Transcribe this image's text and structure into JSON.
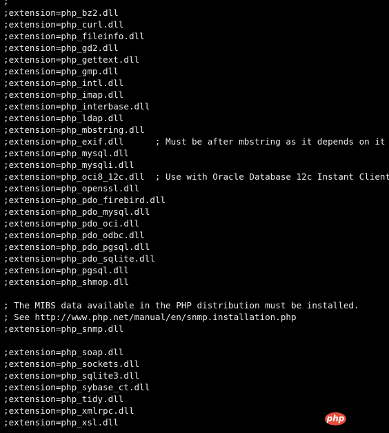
{
  "colors": {
    "background": "#000000",
    "text": "#ececec",
    "badge": "#e74c3c"
  },
  "lines": [
    ";",
    ";extension=php_bz2.dll",
    ";extension=php_curl.dll",
    ";extension=php_fileinfo.dll",
    ";extension=php_gd2.dll",
    ";extension=php_gettext.dll",
    ";extension=php_gmp.dll",
    ";extension=php_intl.dll",
    ";extension=php_imap.dll",
    ";extension=php_interbase.dll",
    ";extension=php_ldap.dll",
    ";extension=php_mbstring.dll",
    ";extension=php_exif.dll      ; Must be after mbstring as it depends on it",
    ";extension=php_mysql.dll",
    ";extension=php_mysqli.dll",
    ";extension=php_oci8_12c.dll  ; Use with Oracle Database 12c Instant Client",
    ";extension=php_openssl.dll",
    ";extension=php_pdo_firebird.dll",
    ";extension=php_pdo_mysql.dll",
    ";extension=php_pdo_oci.dll",
    ";extension=php_pdo_odbc.dll",
    ";extension=php_pdo_pgsql.dll",
    ";extension=php_pdo_sqlite.dll",
    ";extension=php_pgsql.dll",
    ";extension=php_shmop.dll",
    "",
    "; The MIBS data available in the PHP distribution must be installed.",
    "; See http://www.php.net/manual/en/snmp.installation.php",
    ";extension=php_snmp.dll",
    "",
    ";extension=php_soap.dll",
    ";extension=php_sockets.dll",
    ";extension=php_sqlite3.dll",
    ";extension=php_sybase_ct.dll",
    ";extension=php_tidy.dll",
    ";extension=php_xmlrpc.dll",
    ";extension=php_xsl.dll"
  ],
  "watermark": {
    "text": "php"
  }
}
